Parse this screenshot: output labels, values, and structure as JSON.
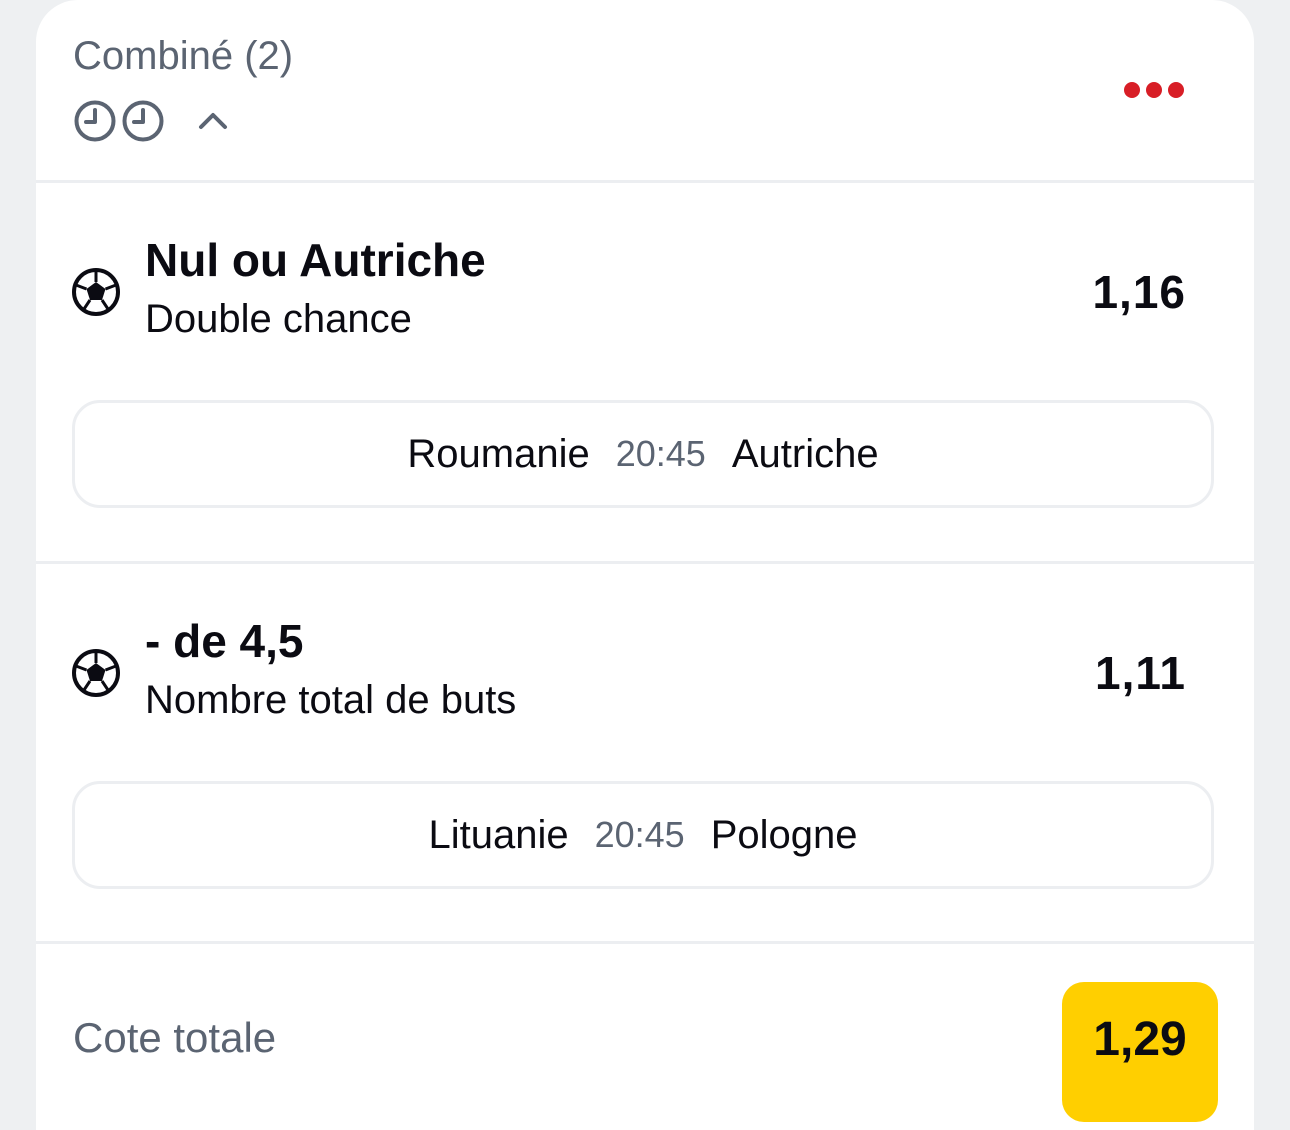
{
  "header": {
    "title": "Combiné (2)",
    "icons": [
      "clock-icon",
      "clock-icon",
      "chevron-up-icon"
    ],
    "more_icon": "more-horizontal-icon",
    "accent_color": "#d81e26"
  },
  "selections": [
    {
      "sport_icon": "soccer-ball-icon",
      "title": "Nul ou Autriche",
      "market": "Double chance",
      "odds": "1,16",
      "match": {
        "home": "Roumanie",
        "time": "20:45",
        "away": "Autriche"
      }
    },
    {
      "sport_icon": "soccer-ball-icon",
      "title": "- de 4,5",
      "market": "Nombre total de buts",
      "odds": "1,11",
      "match": {
        "home": "Lituanie",
        "time": "20:45",
        "away": "Pologne"
      }
    }
  ],
  "footer": {
    "total_label": "Cote totale",
    "total_odds": "1,29",
    "badge_color": "#ffcf00"
  }
}
